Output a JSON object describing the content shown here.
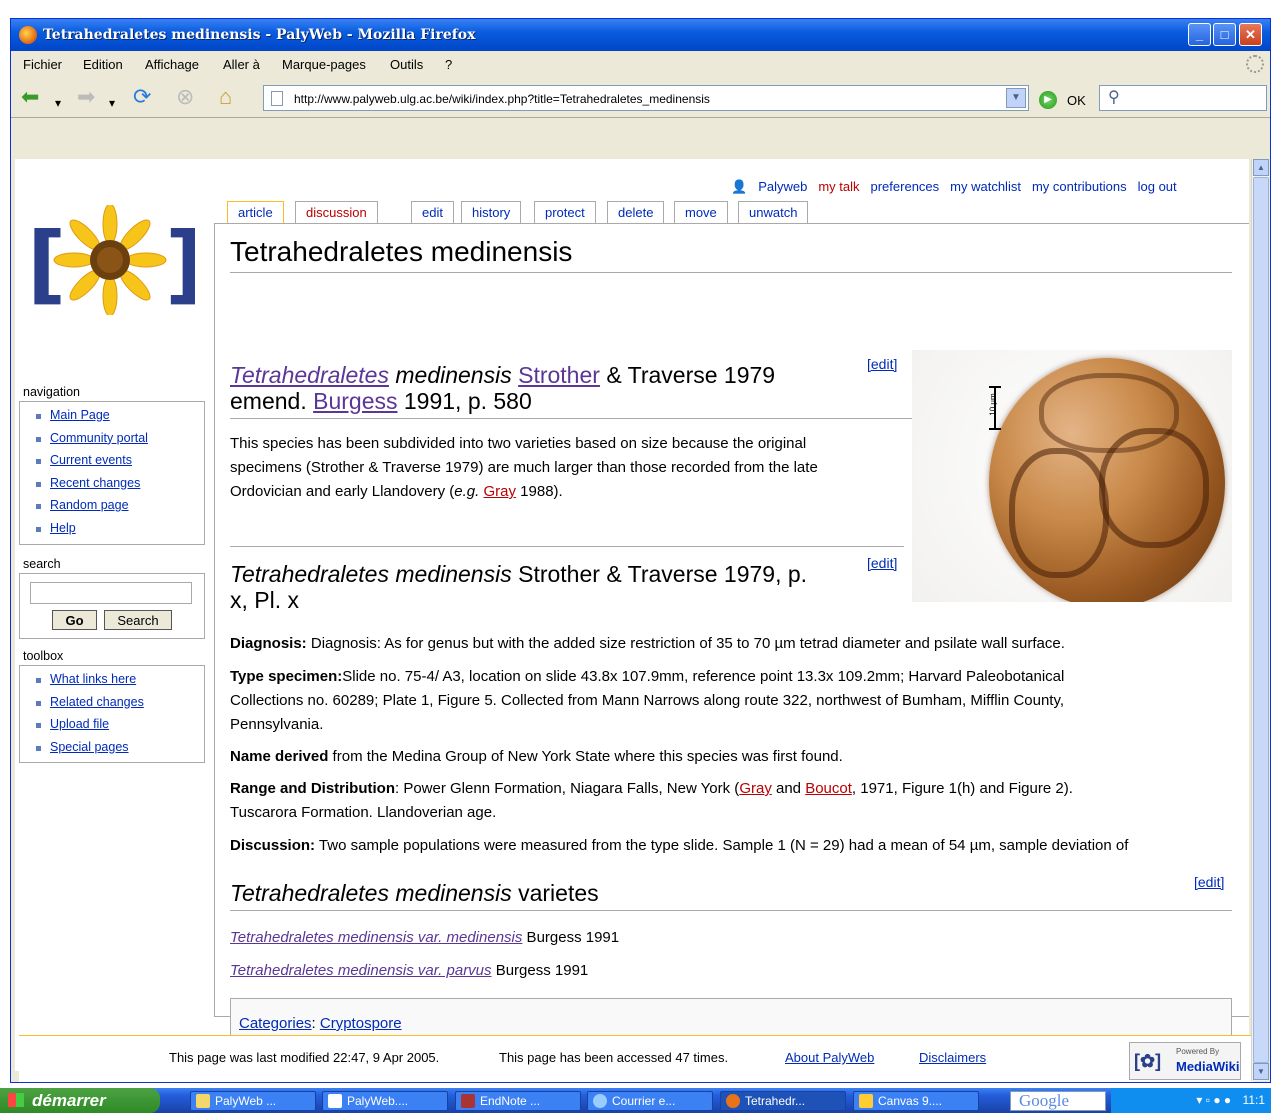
{
  "window": {
    "title": "Tetrahedraletes medinensis - PalyWeb - Mozilla Firefox"
  },
  "menu": [
    "Fichier",
    "Edition",
    "Affichage",
    "Aller à",
    "Marque-pages",
    "Outils",
    "?"
  ],
  "toolbar": {
    "url": "http://www.palyweb.ulg.ac.be/wiki/index.php?title=Tetrahedraletes_medinensis",
    "ok_label": "OK"
  },
  "personal": {
    "user": "Palyweb",
    "items": [
      "my talk",
      "preferences",
      "my watchlist",
      "my contributions",
      "log out"
    ]
  },
  "tabs": [
    "article",
    "discussion",
    "edit",
    "history",
    "protect",
    "delete",
    "move",
    "unwatch"
  ],
  "sidebar": {
    "navigation_title": "navigation",
    "navigation": [
      "Main Page",
      "Community portal",
      "Current events",
      "Recent changes",
      "Random page",
      "Help"
    ],
    "search_title": "search",
    "go_label": "Go",
    "search_label": "Search",
    "toolbox_title": "toolbox",
    "toolbox": [
      "What links here",
      "Related changes",
      "Upload file",
      "Special pages"
    ]
  },
  "article": {
    "title": "Tetrahedraletes medinensis",
    "edit": "[edit]",
    "h2a": {
      "genus": "Tetrahedraletes",
      "species": " medinensis ",
      "author1": "Strother",
      "rest1": " & Traverse 1979",
      "line2a": "emend. ",
      "author2": "Burgess",
      "line2b": " 1991, p. 580"
    },
    "intro": {
      "t1": "This species has been subdivided into two varieties based on size because the original",
      "t2": "specimens (Strother & Traverse 1979) are much larger than those recorded from the late",
      "t3": "Ordovician and early Llandovery (",
      "eg": "e.g.",
      "gray": "Gray",
      "t4": " 1988)."
    },
    "h2b": {
      "italic": "Tetrahedraletes medinensis",
      "rest": " Strother & Traverse 1979, p.",
      "line2": "x, Pl. x"
    },
    "diagnosis": {
      "label": "Diagnosis:",
      "text": " Diagnosis: As for genus but with the added size restriction of 35 to 70 µm tetrad diameter and psilate wall surface."
    },
    "type_specimen": {
      "label": "Type specimen:",
      "l1": "Slide no. 75-4/ A3, location on slide 43.8x 107.9mm, reference point 13.3x 109.2mm; Harvard Paleobotanical",
      "l2": "Collections no. 60289; Plate 1, Figure 5. Collected from Mann Narrows along route 322, northwest of Bumham, Mifflin County,",
      "l3": "Pennsylvania."
    },
    "name_derived": {
      "label": "Name derived",
      "text": " from the Medina Group of New York State where this species was first found."
    },
    "range": {
      "label": "Range and Distribution",
      "t1": ": Power Glenn Formation, Niagara Falls, New York (",
      "gray": "Gray",
      "and": " and ",
      "boucot": "Boucot",
      "t2": ", 1971, Figure 1(h) and Figure 2).",
      "l2": "Tuscarora Formation. Llandoverian age."
    },
    "discussion": {
      "label": "Discussion:",
      "text": " Two sample populations were measured from the type slide. Sample 1 (N = 29) had a mean of 54 µm, sample deviation of"
    },
    "varietes": {
      "italic": "Tetrahedraletes medinensis",
      "rest": " varietes"
    },
    "var1": {
      "link": "Tetrahedraletes medinensis var. medinensis",
      "rest": " Burgess 1991"
    },
    "var2": {
      "link": "Tetrahedraletes medinensis var. parvus",
      "rest": " Burgess 1991"
    },
    "categories_label": "Categories",
    "category": "Cryptospore",
    "scale_label": "10 µm"
  },
  "footer": {
    "modified": "This page was last modified 22:47, 9 Apr 2005.",
    "accessed": "This page has been accessed 47 times.",
    "about": "About PalyWeb",
    "disclaimers": "Disclaimers",
    "badge_top": "Powered By",
    "badge": "MediaWiki"
  },
  "taskbar": {
    "start": "démarrer",
    "tasks": [
      "PalyWeb ...",
      "PalyWeb....",
      "EndNote ...",
      "Courrier e...",
      "Tetrahedr...",
      "Canvas 9...."
    ],
    "search_word": "Google",
    "clock": "11:1"
  },
  "colors": {
    "link": "#002bb8",
    "new_link": "#ba0000",
    "visited": "#5a3696",
    "tab_selected": "#fabd23"
  }
}
